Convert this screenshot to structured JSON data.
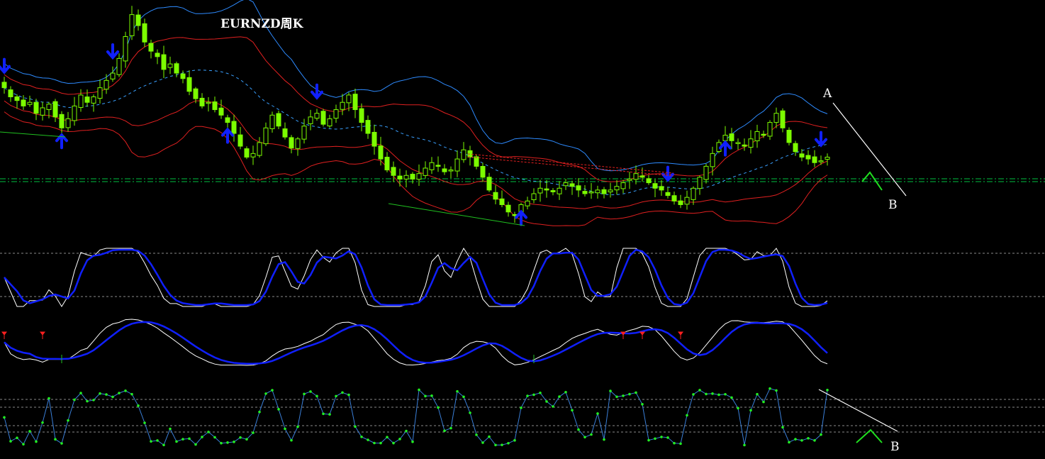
{
  "chart_data": {
    "type": "candlestick",
    "title": "EURNZD周K",
    "annotations": [
      "A",
      "B",
      "B"
    ],
    "colors": {
      "background": "#000000",
      "candle": "#7CFC00",
      "bollinger_outer": "#2e8bff",
      "bollinger_inner": "#e02020",
      "arrow": "#1020ff",
      "signal_main": "#ffffff",
      "signal_avg": "#1020ff",
      "level_line": "#00c040",
      "osc_line": "#3a7fd8",
      "osc_dots": "#22ee22",
      "red_mark": "#ff2020"
    },
    "closes": [
      1.752,
      1.747,
      1.745,
      1.742,
      1.744,
      1.738,
      1.741,
      1.743,
      1.736,
      1.73,
      1.735,
      1.742,
      1.748,
      1.744,
      1.747,
      1.752,
      1.756,
      1.76,
      1.768,
      1.78,
      1.792,
      1.786,
      1.777,
      1.772,
      1.769,
      1.762,
      1.765,
      1.76,
      1.757,
      1.75,
      1.746,
      1.742,
      1.744,
      1.74,
      1.737,
      1.733,
      1.727,
      1.72,
      1.714,
      1.716,
      1.722,
      1.73,
      1.737,
      1.731,
      1.725,
      1.719,
      1.724,
      1.731,
      1.736,
      1.738,
      1.732,
      1.735,
      1.74,
      1.744,
      1.748,
      1.74,
      1.733,
      1.727,
      1.72,
      1.713,
      1.707,
      1.704,
      1.702,
      1.704,
      1.702,
      1.705,
      1.708,
      1.711,
      1.709,
      1.706,
      1.707,
      1.713,
      1.718,
      1.714,
      1.709,
      1.703,
      1.696,
      1.691,
      1.688,
      1.684,
      1.682,
      1.688,
      1.69,
      1.694,
      1.697,
      1.696,
      1.695,
      1.697,
      1.7,
      1.698,
      1.696,
      1.694,
      1.695,
      1.696,
      1.694,
      1.696,
      1.698,
      1.7,
      1.702,
      1.705,
      1.703,
      1.7,
      1.697,
      1.696,
      1.693,
      1.69,
      1.688,
      1.692,
      1.697,
      1.703,
      1.709,
      1.716,
      1.722,
      1.726,
      1.723,
      1.722,
      1.72,
      1.724,
      1.728,
      1.726,
      1.733,
      1.738,
      1.73,
      1.722,
      1.717,
      1.714,
      1.713,
      1.711,
      1.712,
      1.714
    ],
    "price_range": [
      1.668,
      1.8
    ],
    "signal_panel_levels": [
      80,
      20
    ],
    "oscillator_levels": [
      80,
      70,
      30,
      20
    ]
  }
}
